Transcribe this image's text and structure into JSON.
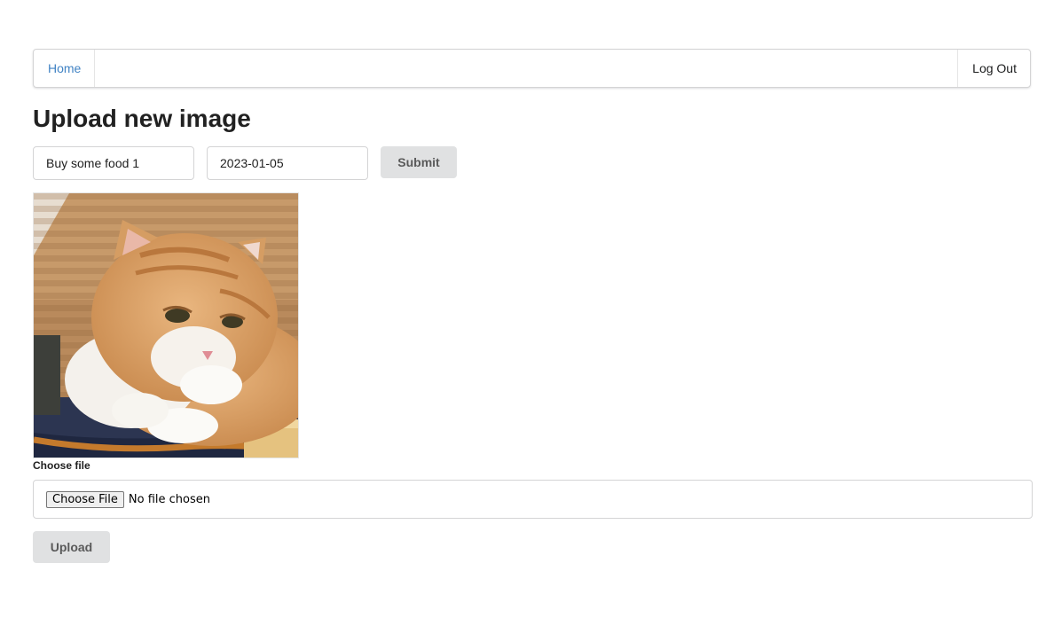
{
  "nav": {
    "home_label": "Home",
    "logout_label": "Log Out"
  },
  "page": {
    "title": "Upload new image"
  },
  "form": {
    "title_value": "Buy some food 1",
    "date_value": "2023-01-05",
    "submit_label": "Submit"
  },
  "image": {
    "alt": "orange and white cat"
  },
  "upload": {
    "file_label": "Choose file",
    "choose_button": "Choose File",
    "file_status": "No file chosen",
    "upload_label": "Upload"
  },
  "colors": {
    "link": "#4183c4",
    "button_bg": "#e0e1e2",
    "button_text": "#5a5a5a"
  }
}
